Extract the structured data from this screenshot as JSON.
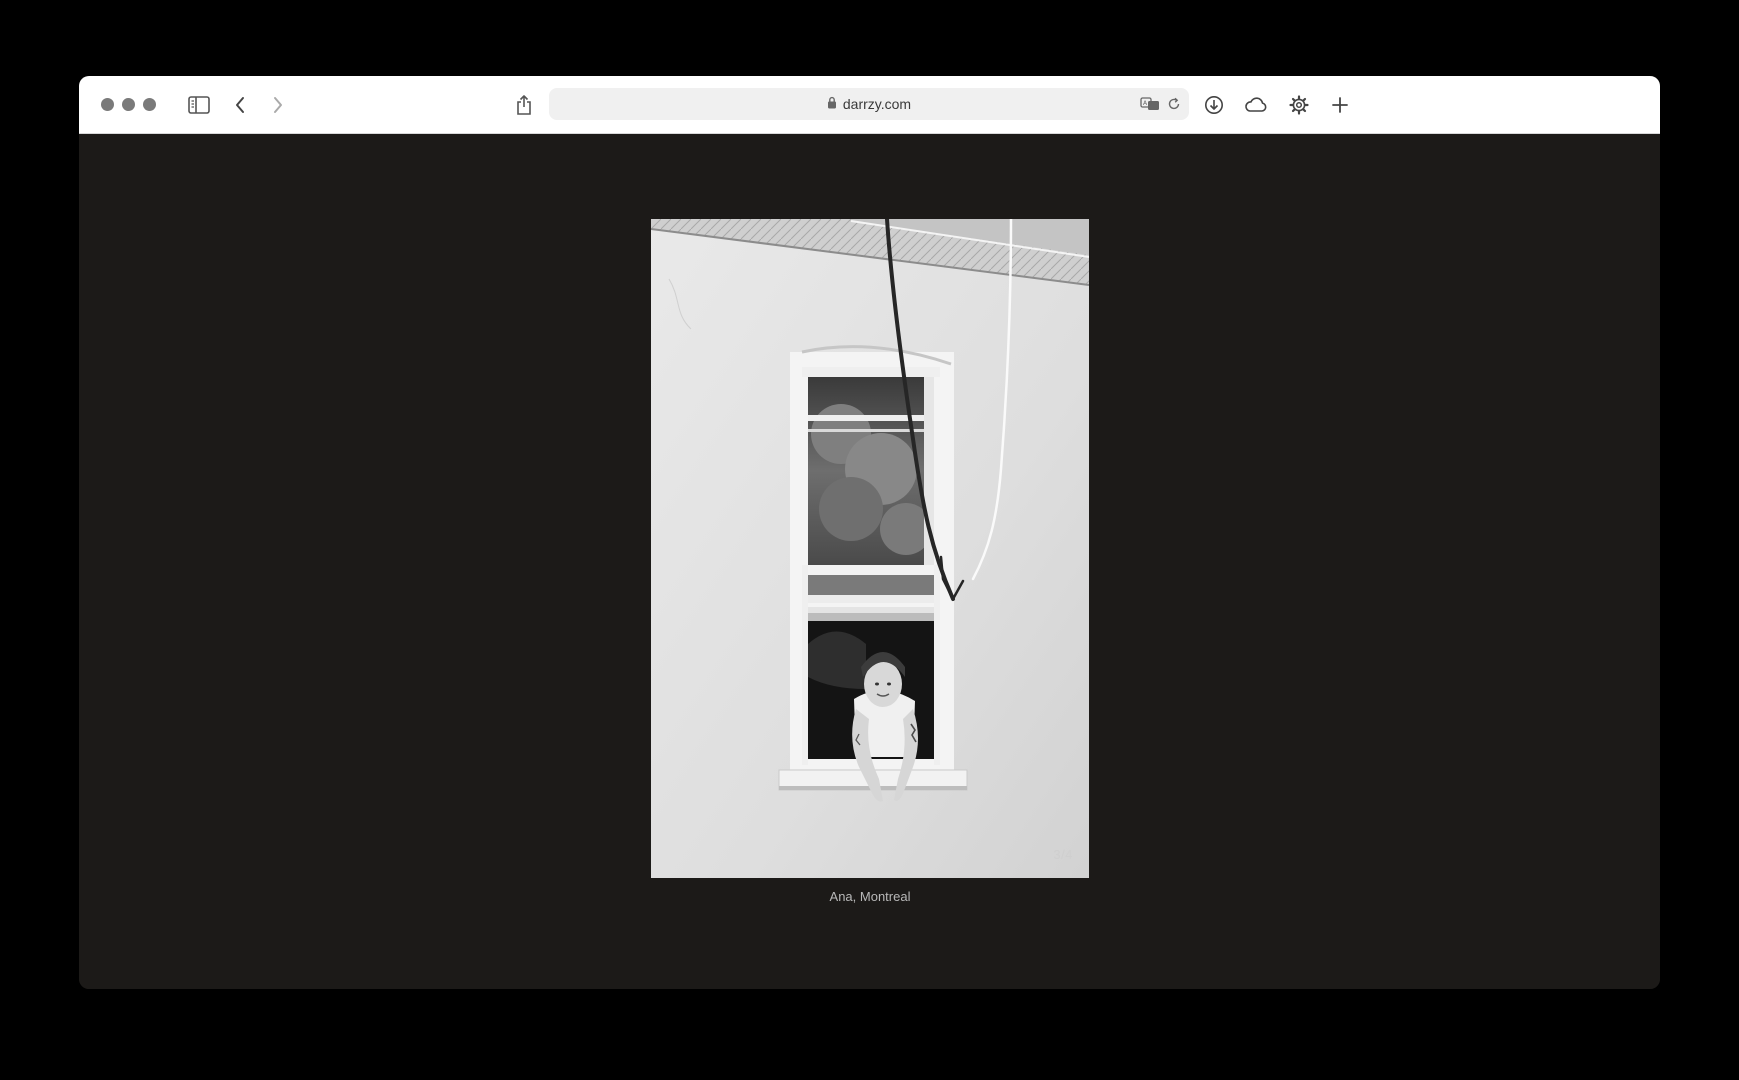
{
  "browser": {
    "url": "darrzy.com",
    "icons": {
      "close": "traffic-light-close",
      "minimize": "traffic-light-minimize",
      "maximize": "traffic-light-maximize",
      "sidebar": "sidebar-icon",
      "back": "chevron-left-icon",
      "forward": "chevron-right-icon",
      "share": "share-icon",
      "lock": "lock-icon",
      "translate": "translate-icon",
      "reload": "reload-icon",
      "downloads": "download-icon",
      "cloud": "cloud-icon",
      "settings": "gear-icon",
      "new_tab": "plus-icon"
    }
  },
  "gallery": {
    "counter": "3/4",
    "caption": "Ana, Montreal"
  },
  "colors": {
    "page_background": "#1c1a18",
    "toolbar_background": "#ffffff",
    "caption_text": "#b8b8b8"
  }
}
